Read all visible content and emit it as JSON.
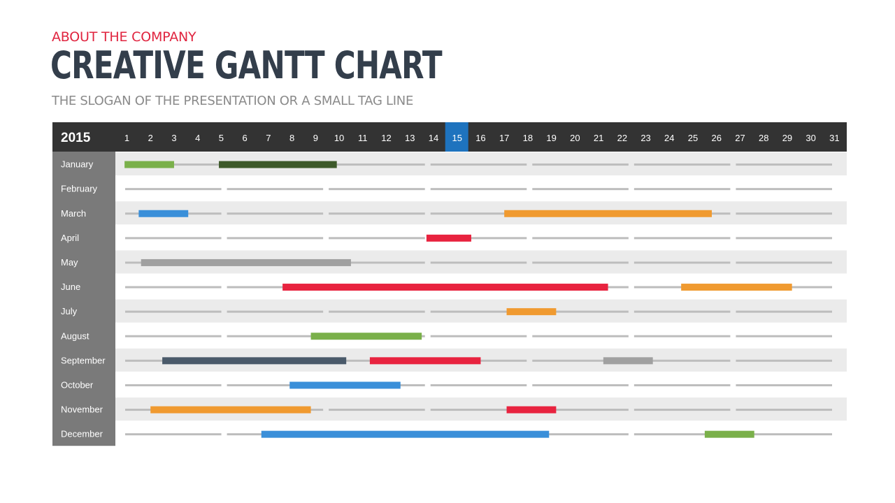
{
  "header": {
    "kicker": "ABOUT THE COMPANY",
    "title": "CREATIVE GANTT CHART",
    "slogan": "THE SLOGAN OF THE PRESENTATION OR A SMALL TAG LINE"
  },
  "chart_data": {
    "type": "gantt",
    "title": "CREATIVE GANTT CHART",
    "year_label": "2015",
    "x_ticks": [
      "1",
      "2",
      "3",
      "4",
      "5",
      "6",
      "7",
      "8",
      "9",
      "10",
      "11",
      "12",
      "13",
      "14",
      "15",
      "16",
      "17",
      "18",
      "19",
      "20",
      "21",
      "22",
      "23",
      "24",
      "25",
      "26",
      "27",
      "28",
      "29",
      "30",
      "31"
    ],
    "highlighted_tick": "15",
    "x_range": [
      1,
      31
    ],
    "categories": [
      "January",
      "February",
      "March",
      "April",
      "May",
      "June",
      "July",
      "August",
      "September",
      "October",
      "November",
      "December"
    ],
    "colors": {
      "green": "#7ab04a",
      "dark_green": "#3d5a2a",
      "blue": "#3a8fd9",
      "orange": "#f09a30",
      "red": "#e8233f",
      "gray": "#a0a0a0",
      "slate": "#4a5a6a",
      "header_bg": "#333333",
      "highlight": "#1e73be",
      "month_col_bg": "#7a7a7a",
      "row_alt_bg": "#ebebeb",
      "track": "#bdbdbd"
    },
    "tasks": [
      {
        "month": "January",
        "start": 0.9,
        "end": 3.0,
        "color": "green"
      },
      {
        "month": "January",
        "start": 4.9,
        "end": 9.9,
        "color": "dark_green"
      },
      {
        "month": "March",
        "start": 1.5,
        "end": 3.6,
        "color": "blue"
      },
      {
        "month": "March",
        "start": 17.0,
        "end": 25.8,
        "color": "orange"
      },
      {
        "month": "April",
        "start": 13.7,
        "end": 15.6,
        "color": "red"
      },
      {
        "month": "May",
        "start": 1.6,
        "end": 10.5,
        "color": "gray"
      },
      {
        "month": "June",
        "start": 7.6,
        "end": 21.4,
        "color": "red"
      },
      {
        "month": "June",
        "start": 24.5,
        "end": 29.2,
        "color": "orange"
      },
      {
        "month": "July",
        "start": 17.1,
        "end": 19.2,
        "color": "orange"
      },
      {
        "month": "August",
        "start": 8.8,
        "end": 13.5,
        "color": "green"
      },
      {
        "month": "September",
        "start": 2.5,
        "end": 10.3,
        "color": "slate"
      },
      {
        "month": "September",
        "start": 11.3,
        "end": 16.0,
        "color": "red"
      },
      {
        "month": "September",
        "start": 21.2,
        "end": 23.3,
        "color": "gray"
      },
      {
        "month": "October",
        "start": 7.9,
        "end": 12.6,
        "color": "blue"
      },
      {
        "month": "November",
        "start": 2.0,
        "end": 8.8,
        "color": "orange"
      },
      {
        "month": "November",
        "start": 17.1,
        "end": 19.2,
        "color": "red"
      },
      {
        "month": "December",
        "start": 6.7,
        "end": 18.9,
        "color": "blue"
      },
      {
        "month": "December",
        "start": 25.5,
        "end": 27.6,
        "color": "green"
      }
    ],
    "track_segments": 7,
    "grid": false,
    "legend": "none"
  }
}
